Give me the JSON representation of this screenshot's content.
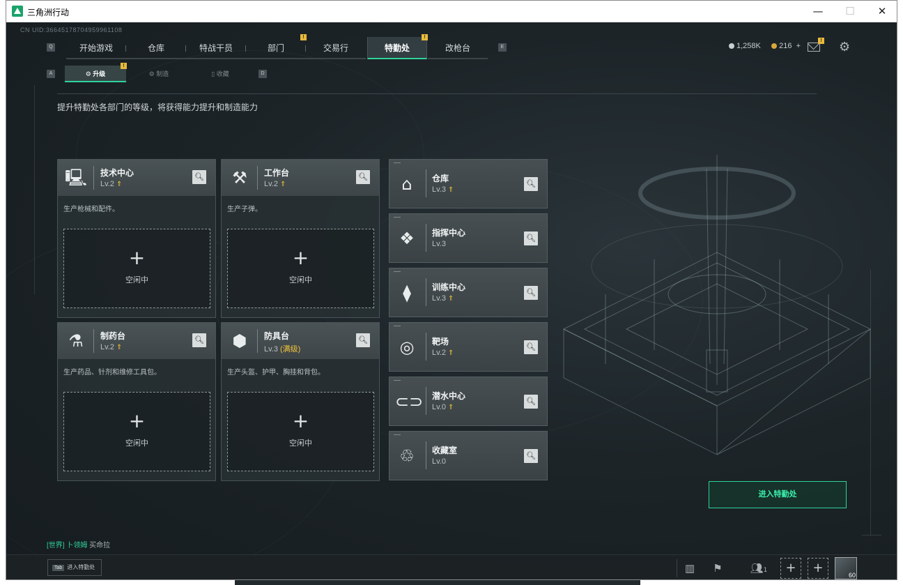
{
  "window": {
    "title": "三角洲行动",
    "controls": {
      "minimize": "—",
      "maximize": "☐",
      "close": "✕"
    }
  },
  "uid": "CN UID:36645178704959961108",
  "nav": {
    "left_key": "Q",
    "right_key": "E",
    "tabs": [
      {
        "label": "开始游戏",
        "active": false,
        "badge": ""
      },
      {
        "label": "仓库",
        "active": false,
        "badge": ""
      },
      {
        "label": "特战干员",
        "active": false,
        "badge": ""
      },
      {
        "label": "部门",
        "active": false,
        "badge": "!"
      },
      {
        "label": "交易行",
        "active": false,
        "badge": ""
      },
      {
        "label": "特勤处",
        "active": true,
        "badge": "!"
      },
      {
        "label": "改枪台",
        "active": false,
        "badge": ""
      }
    ]
  },
  "resources": {
    "currency1": "1,258K",
    "currency2": "216",
    "add": "+"
  },
  "mail_badge": "!",
  "subnav": {
    "left_key": "A",
    "right_key": "D",
    "tabs": [
      {
        "label": "升级",
        "active": true,
        "badge": "!"
      },
      {
        "label": "制造",
        "active": false
      },
      {
        "label": "收藏",
        "active": false
      }
    ]
  },
  "description": "提升特勤处各部门的等级，将获得能力提升和制造能力",
  "production_cards": [
    {
      "name": "技术中心",
      "level": "Lv.2",
      "upgradable": true,
      "desc": "生产枪械和配件。",
      "slot": "空闲中",
      "icon": "computer-icon"
    },
    {
      "name": "工作台",
      "level": "Lv.2",
      "upgradable": true,
      "desc": "生产子弹。",
      "slot": "空闲中",
      "icon": "tools-icon"
    },
    {
      "name": "制药台",
      "level": "Lv.2",
      "upgradable": true,
      "desc": "生产药品、针剂和维修工具包。",
      "slot": "空闲中",
      "icon": "microscope-icon"
    },
    {
      "name": "防具台",
      "level": "Lv.3",
      "maxed": "(满级)",
      "upgradable": false,
      "desc": "生产头盔、护甲、胸挂和背包。",
      "slot": "空闲中",
      "icon": "armor-icon"
    }
  ],
  "departments": [
    {
      "name": "仓库",
      "level": "Lv.3",
      "upgradable": true,
      "icon": "warehouse-icon"
    },
    {
      "name": "指挥中心",
      "level": "Lv.3",
      "upgradable": false,
      "icon": "command-icon"
    },
    {
      "name": "训练中心",
      "level": "Lv.3",
      "upgradable": true,
      "icon": "dumbbell-icon"
    },
    {
      "name": "靶场",
      "level": "Lv.2",
      "upgradable": true,
      "icon": "target-icon"
    },
    {
      "name": "潜水中心",
      "level": "Lv.0",
      "upgradable": true,
      "icon": "diving-icon"
    },
    {
      "name": "收藏室",
      "level": "Lv.0",
      "upgradable": false,
      "icon": "collection-icon"
    }
  ],
  "enter_button": "进入特勤处",
  "chat": {
    "channel": "[世界]",
    "user": "卜领姆",
    "message": "买命拉"
  },
  "bottom": {
    "tab_key": "Tab",
    "tab_label": "进入特勤处",
    "friends_count": "1",
    "avatar_level": "60"
  },
  "colors": {
    "accent": "#2fd39a",
    "badge": "#e8b93a",
    "upgrade": "#f0c23a"
  }
}
